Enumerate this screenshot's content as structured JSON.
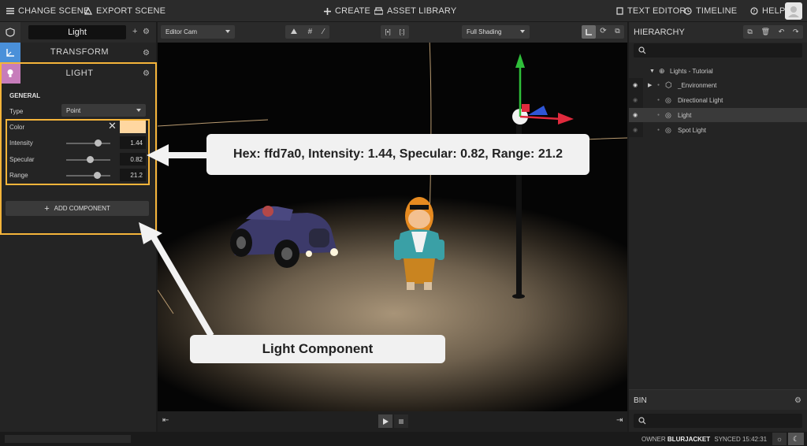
{
  "topbar": {
    "change_scene": "CHANGE SCENE",
    "export_scene": "EXPORT SCENE",
    "create": "CREATE",
    "asset_library": "ASSET LIBRARY",
    "text_editor": "TEXT EDITOR",
    "timeline": "TIMELINE",
    "help": "HELP"
  },
  "inspector": {
    "entity_name": "Light",
    "transform_title": "TRANSFORM",
    "light_title": "LIGHT",
    "general_label": "GENERAL",
    "type_label": "Type",
    "type_value": "Point",
    "color_label": "Color",
    "color_hex": "#ffd7a0",
    "intensity_label": "Intensity",
    "intensity_value": "1.44",
    "intensity_fraction": 0.72,
    "specular_label": "Specular",
    "specular_value": "0.82",
    "specular_fraction": 0.55,
    "range_label": "Range",
    "range_value": "21.2",
    "range_fraction": 0.7,
    "add_component": "ADD COMPONENT"
  },
  "viewport": {
    "camera": "Editor Cam",
    "shading": "Full Shading"
  },
  "hierarchy": {
    "title": "HIERARCHY",
    "items": [
      {
        "label": "Lights - Tutorial",
        "icon": "globe-icon"
      },
      {
        "label": "_Environment",
        "icon": "hexagon-icon"
      },
      {
        "label": "Directional Light",
        "icon": "bulb-icon"
      },
      {
        "label": "Light",
        "icon": "bulb-icon"
      },
      {
        "label": "Spot Light",
        "icon": "bulb-icon"
      }
    ]
  },
  "bin": {
    "title": "BIN"
  },
  "statusbar": {
    "owner_label": "OWNER",
    "owner_name": "BLURJACKET",
    "synced_label": "SYNCED",
    "synced_time": "15:42:31"
  },
  "annotations": {
    "values_callout": "Hex: ffd7a0, Intensity: 1.44, Specular: 0.82, Range: 21.2",
    "component_callout": "Light Component"
  },
  "colors": {
    "accent_orange": "#f5b43a",
    "transform_blue": "#4a90d9",
    "light_purple": "#c77dbb"
  }
}
